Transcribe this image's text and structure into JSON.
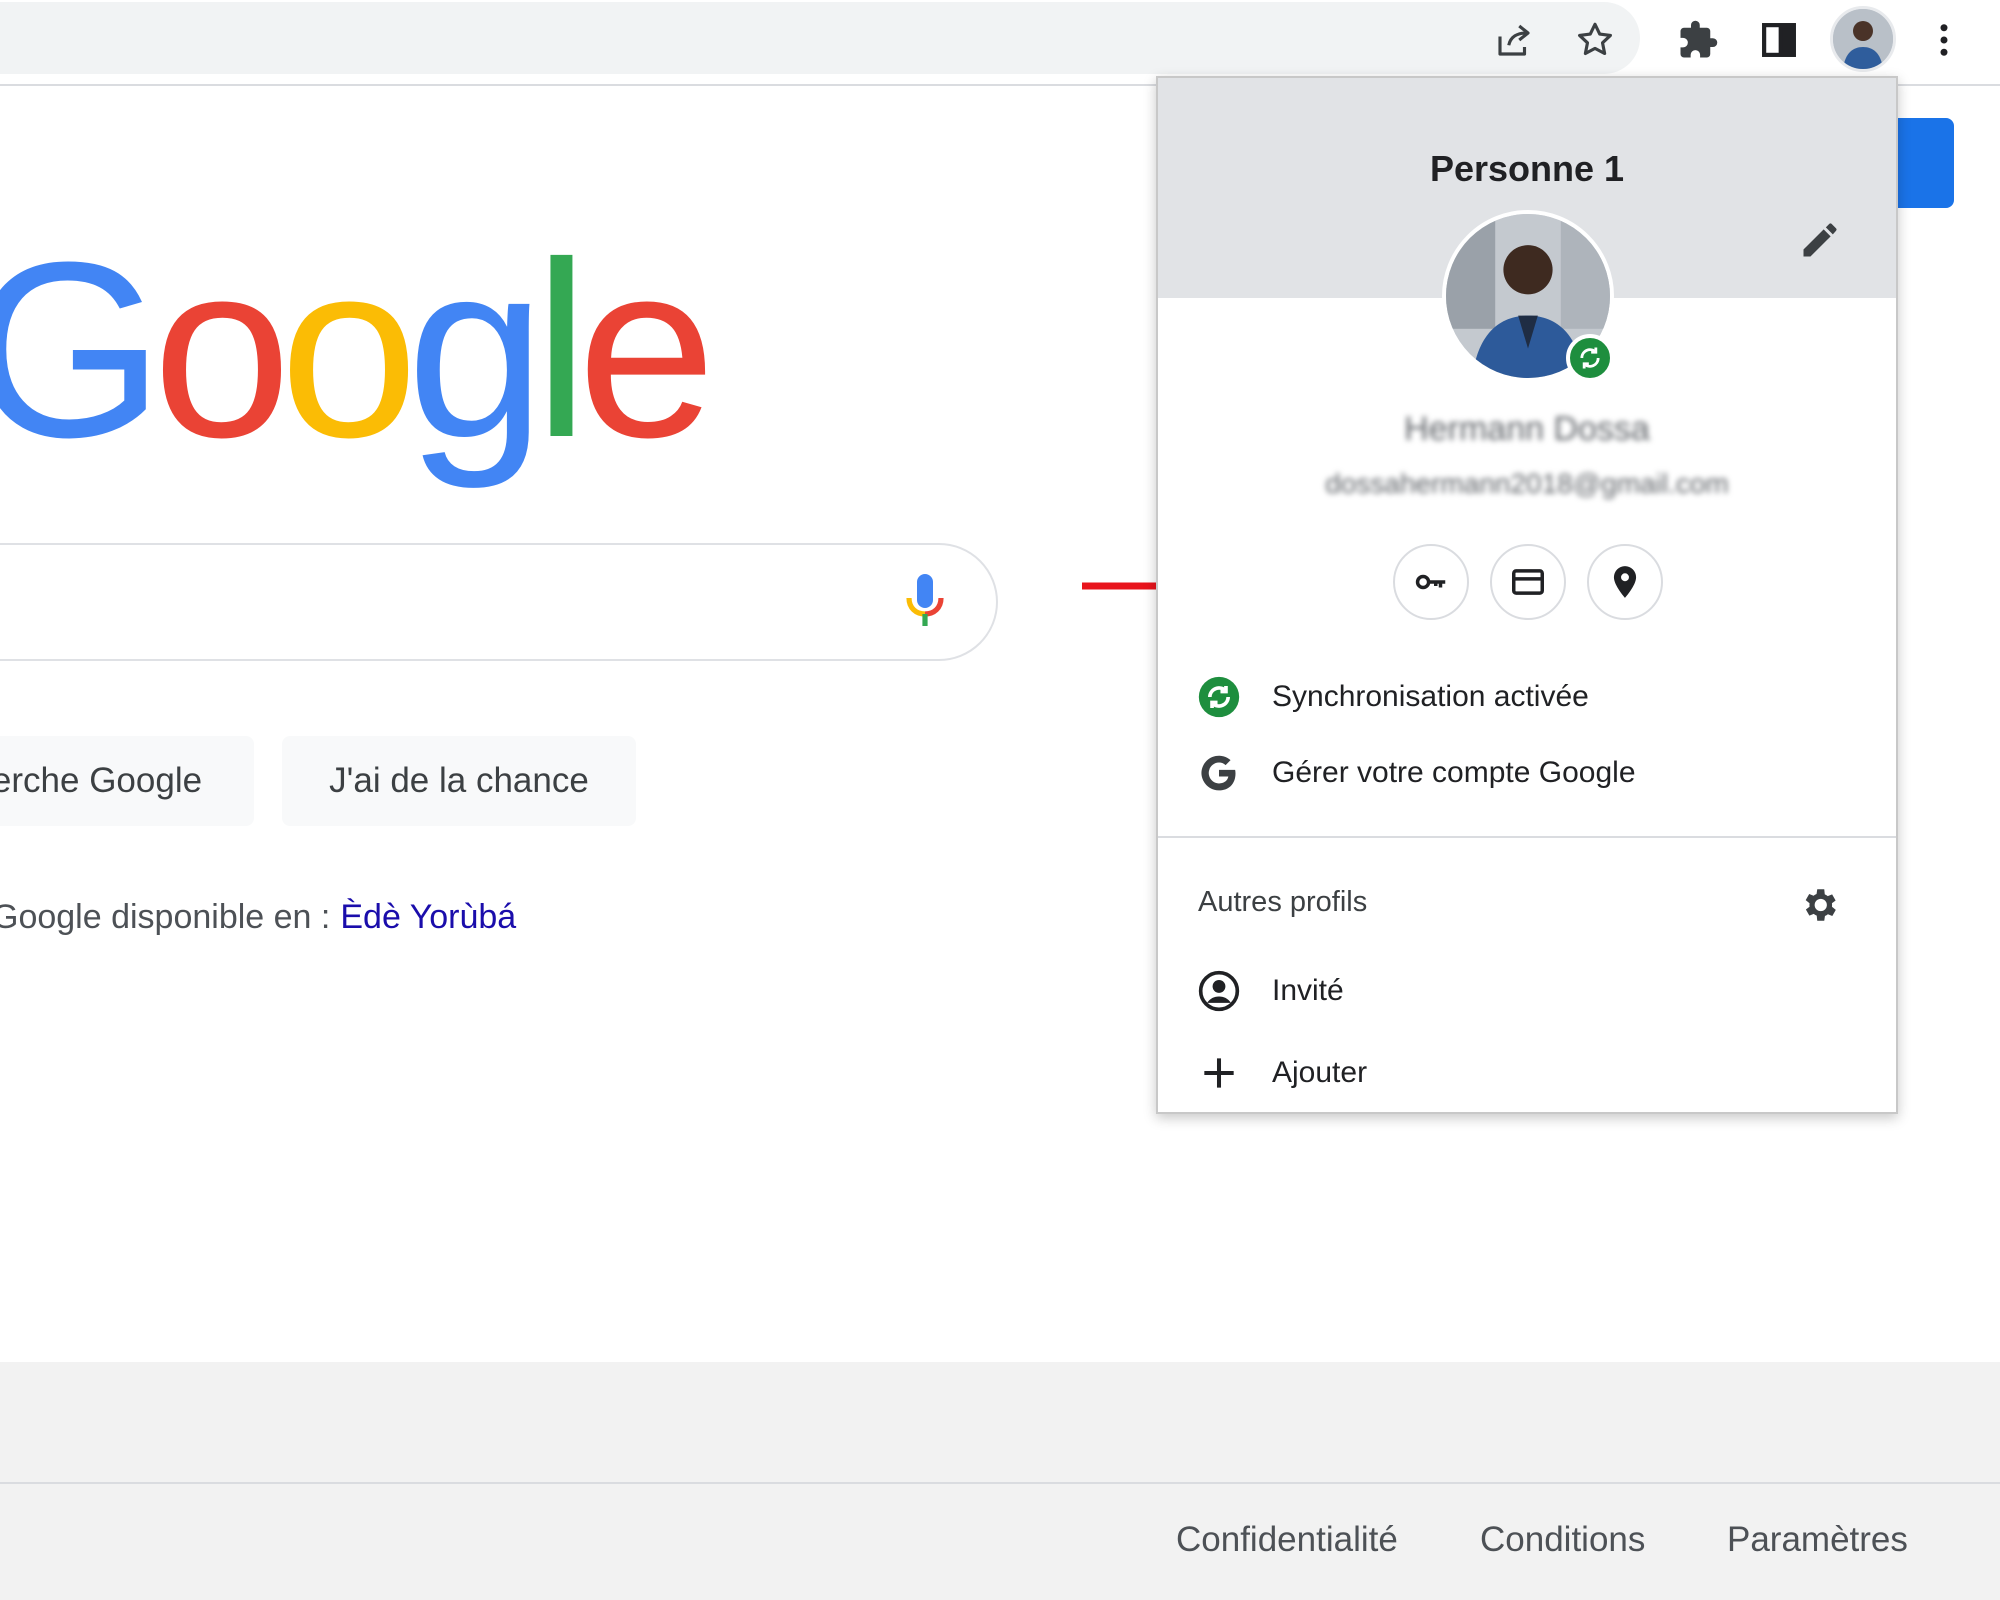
{
  "browser": {
    "toolbar_icons": [
      "share-icon",
      "bookmark-star-icon",
      "extensions-puzzle-icon",
      "side-panel-icon",
      "profile-avatar",
      "more-menu-icon"
    ]
  },
  "google": {
    "logo_letters": [
      {
        "char": "G",
        "color": "#4285F4"
      },
      {
        "char": "o",
        "color": "#EA4335"
      },
      {
        "char": "o",
        "color": "#FBBC05"
      },
      {
        "char": "g",
        "color": "#4285F4"
      },
      {
        "char": "l",
        "color": "#34A853"
      },
      {
        "char": "e",
        "color": "#EA4335"
      }
    ],
    "search_button_label": "erche Google",
    "lucky_button_label": "J'ai de la chance",
    "language_prefix": "Google disponible en :",
    "language_link": "Èdè Yorùbá"
  },
  "footer": {
    "links": [
      "Confidentialité",
      "Conditions",
      "Paramètres"
    ]
  },
  "profile_panel": {
    "title": "Personne 1",
    "user_name": "Hermann Dossa",
    "user_email": "dossahermann2018@gmail.com",
    "quick_actions": [
      "passwords-key-icon",
      "payment-card-icon",
      "addresses-pin-icon"
    ],
    "sync_label": "Synchronisation activée",
    "manage_account_label": "Gérer votre compte Google",
    "other_profiles_title": "Autres profils",
    "guest_label": "Invité",
    "add_label": "Ajouter"
  },
  "colors": {
    "accent_blue": "#1a73e8",
    "sync_green": "#1e8e3e",
    "arrow_red": "#e8141c",
    "link_blue": "#1a0dab"
  }
}
